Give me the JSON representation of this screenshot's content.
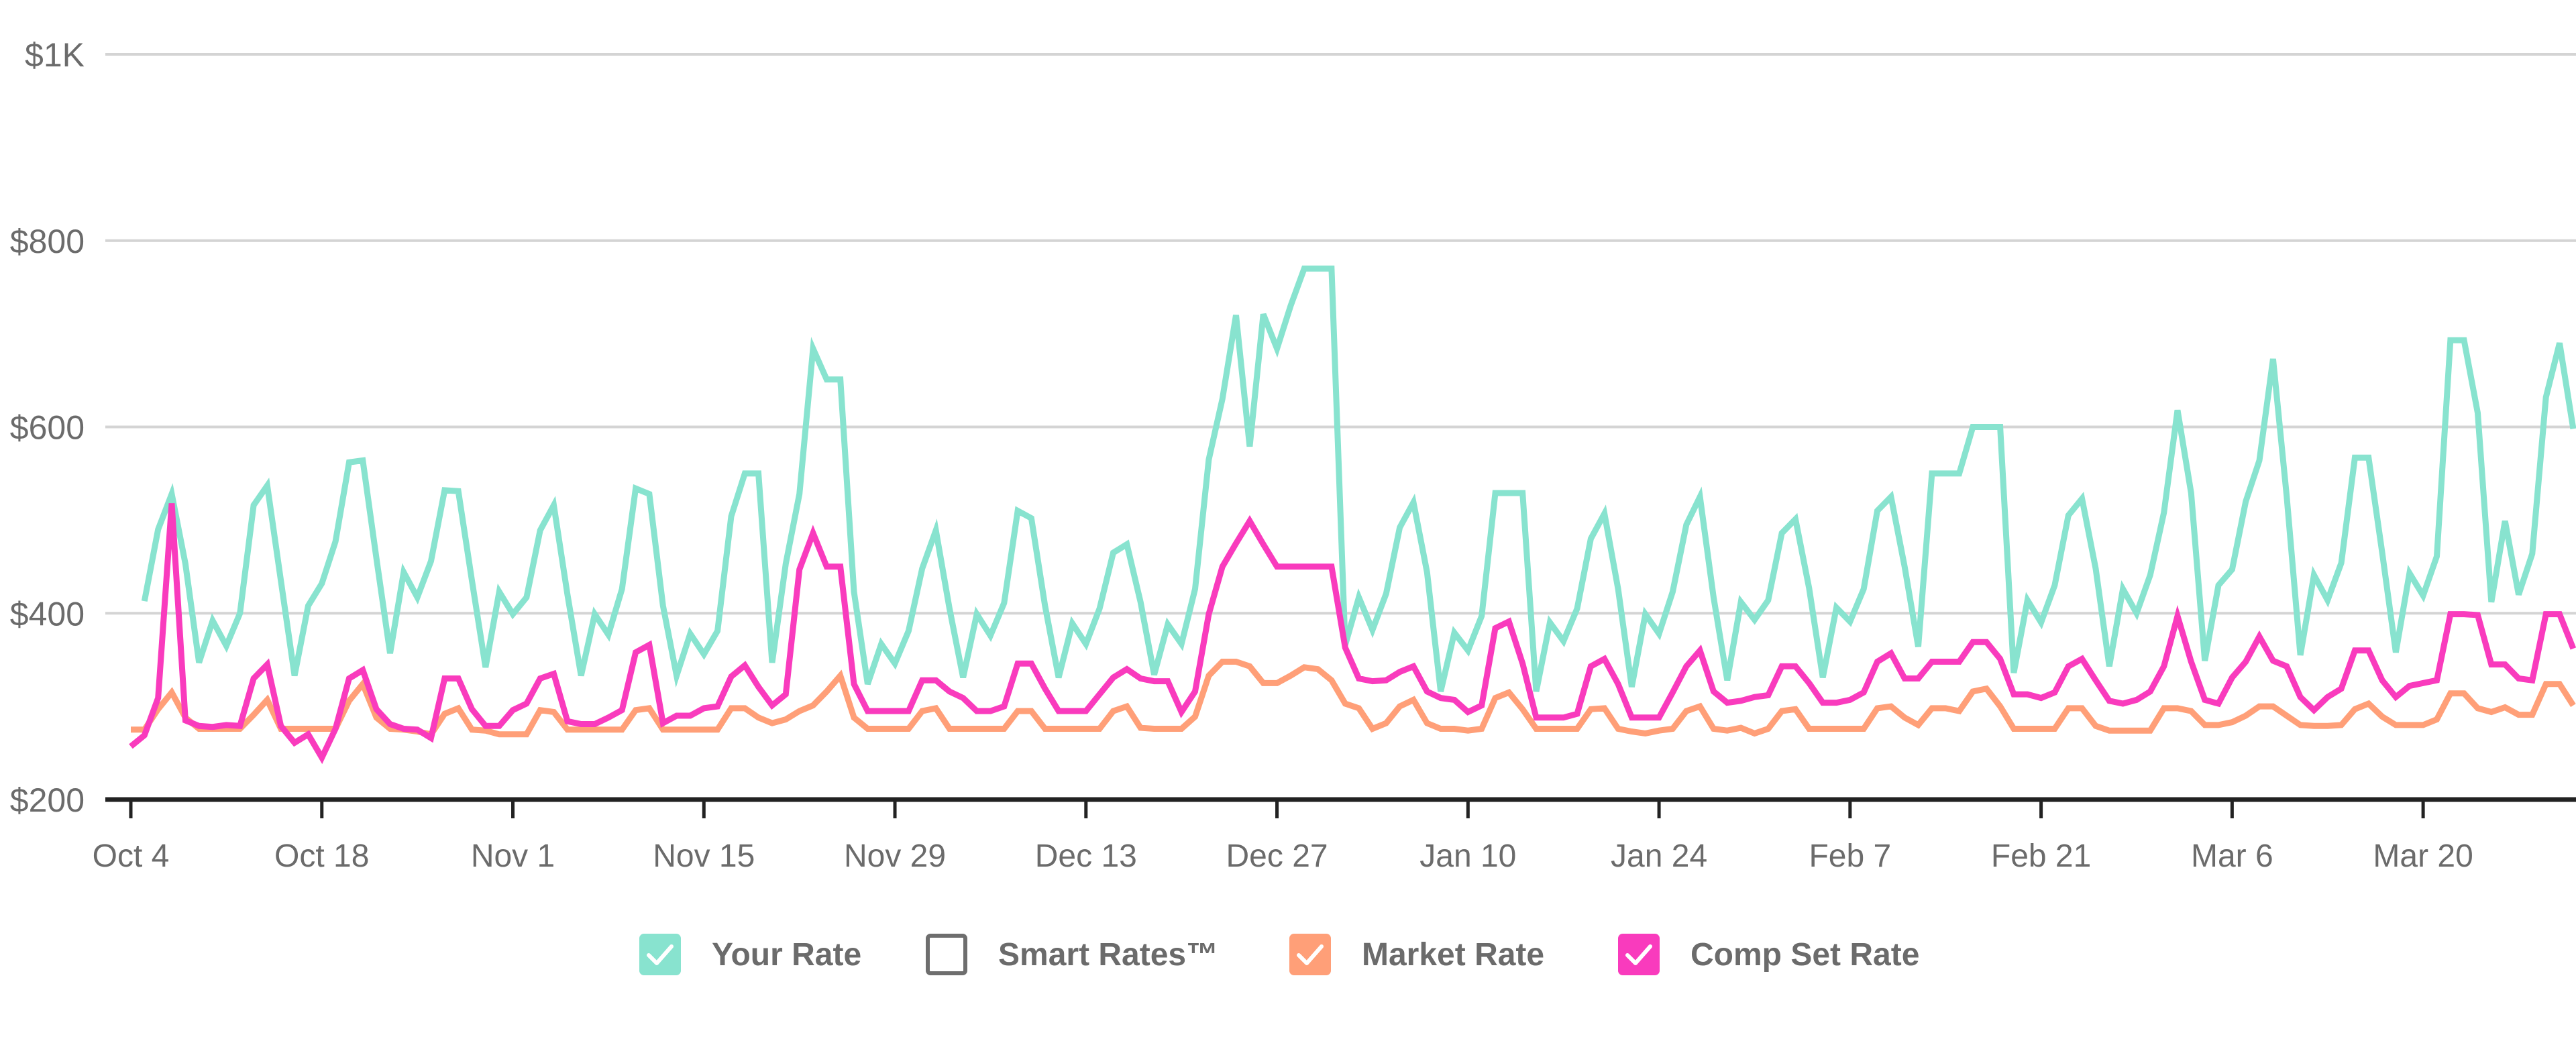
{
  "chart_data": {
    "type": "line",
    "title": "",
    "xlabel": "",
    "ylabel": "",
    "start_date": "Oct 4",
    "x_unit": "day",
    "ylim": [
      200,
      1000
    ],
    "y_ticks": [
      {
        "value": 200,
        "label": "$200"
      },
      {
        "value": 400,
        "label": "$400"
      },
      {
        "value": 600,
        "label": "$600"
      },
      {
        "value": 800,
        "label": "$800"
      },
      {
        "value": 1000,
        "label": "$1K"
      }
    ],
    "x_ticks": [
      {
        "day": 0,
        "label": "Oct 4"
      },
      {
        "day": 14,
        "label": "Oct 18"
      },
      {
        "day": 28,
        "label": "Nov 1"
      },
      {
        "day": 42,
        "label": "Nov 15"
      },
      {
        "day": 56,
        "label": "Nov 29"
      },
      {
        "day": 70,
        "label": "Dec 13"
      },
      {
        "day": 84,
        "label": "Dec 27"
      },
      {
        "day": 98,
        "label": "Jan 10"
      },
      {
        "day": 112,
        "label": "Jan 24"
      },
      {
        "day": 126,
        "label": "Feb 7"
      },
      {
        "day": 140,
        "label": "Feb 21"
      },
      {
        "day": 154,
        "label": "Mar 6"
      },
      {
        "day": 168,
        "label": "Mar 20"
      }
    ],
    "xlim_days": [
      0,
      179
    ],
    "grid": true,
    "legend_position": "bottom-center",
    "series": [
      {
        "name": "Your Rate",
        "color": "#88e3cf",
        "visible": true,
        "values": [
          null,
          413,
          490,
          528,
          453,
          347,
          392,
          365,
          400,
          516,
          537,
          435,
          333,
          408,
          432,
          477,
          562,
          564,
          459,
          357,
          444,
          417,
          456,
          532,
          531,
          435,
          342,
          423,
          399,
          417,
          489,
          516,
          420,
          333,
          399,
          377,
          426,
          534,
          528,
          408,
          333,
          378,
          356,
          381,
          504,
          550,
          550,
          347,
          453,
          528,
          684,
          651,
          651,
          423,
          324,
          367,
          346,
          381,
          448,
          489,
          405,
          331,
          399,
          376,
          411,
          510,
          502,
          408,
          331,
          389,
          367,
          405,
          465,
          474,
          412,
          334,
          388,
          367,
          426,
          565,
          630,
          720,
          579,
          721,
          684,
          730,
          770,
          770,
          770,
          366,
          417,
          382,
          421,
          492,
          519,
          444,
          316,
          379,
          360,
          397,
          529,
          529,
          529,
          316,
          390,
          370,
          405,
          480,
          507,
          426,
          321,
          399,
          378,
          423,
          495,
          525,
          417,
          328,
          412,
          393,
          414,
          486,
          501,
          427,
          331,
          406,
          391,
          426,
          510,
          525,
          450,
          364,
          550,
          550,
          550,
          600,
          600,
          600,
          336,
          414,
          390,
          430,
          505,
          523,
          448,
          343,
          426,
          400,
          441,
          508,
          618,
          529,
          349,
          430,
          447,
          520,
          564,
          673,
          526,
          355,
          441,
          414,
          454,
          567,
          567,
          465,
          358,
          443,
          419,
          461,
          693,
          693,
          615,
          412,
          499,
          420,
          464,
          632,
          690,
          598
        ]
      },
      {
        "name": "Smart Rates™",
        "color": "#6e6e6e",
        "visible": false,
        "values": []
      },
      {
        "name": "Market Rate",
        "color": "#ff9f78",
        "visible": true,
        "values": [
          275,
          275,
          297,
          315,
          288,
          276,
          276,
          276,
          276,
          291,
          307,
          276,
          276,
          276,
          276,
          276,
          306,
          324,
          288,
          276,
          275,
          273,
          270,
          292,
          298,
          275,
          274,
          270,
          270,
          270,
          296,
          294,
          275,
          275,
          275,
          275,
          275,
          296,
          298,
          275,
          275,
          275,
          275,
          275,
          298,
          298,
          288,
          282,
          286,
          295,
          301,
          316,
          333,
          288,
          276,
          276,
          276,
          276,
          295,
          298,
          276,
          276,
          276,
          276,
          276,
          295,
          295,
          276,
          276,
          276,
          276,
          276,
          295,
          300,
          277,
          276,
          276,
          276,
          289,
          333,
          348,
          348,
          343,
          325,
          325,
          333,
          342,
          340,
          328,
          303,
          298,
          276,
          282,
          300,
          307,
          282,
          276,
          276,
          274,
          276,
          309,
          315,
          297,
          276,
          276,
          276,
          276,
          297,
          298,
          276,
          273,
          271,
          274,
          276,
          295,
          300,
          276,
          274,
          277,
          271,
          276,
          295,
          297,
          276,
          276,
          276,
          276,
          276,
          298,
          300,
          288,
          280,
          298,
          298,
          295,
          316,
          319,
          300,
          276,
          276,
          276,
          276,
          298,
          298,
          279,
          274,
          274,
          274,
          274,
          298,
          298,
          295,
          280,
          280,
          283,
          290,
          300,
          300,
          290,
          280,
          279,
          279,
          280,
          297,
          303,
          289,
          280,
          280,
          280,
          286,
          314,
          314,
          298,
          294,
          299,
          291,
          291,
          324,
          324,
          301
        ]
      },
      {
        "name": "Comp Set Rate",
        "color": "#f93bbd",
        "visible": true,
        "values": [
          257,
          269,
          309,
          518,
          285,
          279,
          278,
          280,
          279,
          330,
          345,
          279,
          261,
          270,
          245,
          276,
          330,
          339,
          297,
          281,
          276,
          275,
          266,
          330,
          330,
          297,
          279,
          279,
          296,
          303,
          330,
          335,
          284,
          281,
          281,
          288,
          296,
          358,
          366,
          282,
          290,
          290,
          298,
          300,
          332,
          344,
          321,
          301,
          313,
          447,
          486,
          450,
          450,
          324,
          295,
          295,
          295,
          295,
          328,
          328,
          316,
          309,
          295,
          295,
          300,
          346,
          346,
          319,
          295,
          295,
          295,
          313,
          331,
          340,
          330,
          327,
          327,
          294,
          316,
          399,
          450,
          475,
          499,
          474,
          450,
          450,
          450,
          450,
          450,
          363,
          330,
          327,
          328,
          337,
          343,
          316,
          309,
          307,
          294,
          301,
          384,
          391,
          346,
          288,
          288,
          288,
          292,
          343,
          351,
          324,
          288,
          288,
          288,
          315,
          343,
          360,
          316,
          304,
          306,
          310,
          312,
          343,
          343,
          325,
          304,
          304,
          307,
          315,
          348,
          357,
          330,
          330,
          348,
          348,
          348,
          369,
          369,
          351,
          313,
          313,
          309,
          315,
          343,
          351,
          328,
          306,
          303,
          307,
          316,
          343,
          397,
          348,
          307,
          303,
          331,
          348,
          375,
          349,
          343,
          310,
          296,
          310,
          319,
          360,
          360,
          328,
          310,
          322,
          325,
          328,
          399,
          399,
          398,
          345,
          345,
          330,
          328,
          399,
          399,
          362
        ]
      }
    ]
  },
  "legend": {
    "items": [
      {
        "label": "Your Rate",
        "checked": true,
        "color": "#88e3cf"
      },
      {
        "label": "Smart Rates™",
        "checked": false,
        "color": "#6e6e6e"
      },
      {
        "label": "Market Rate",
        "checked": true,
        "color": "#ff9f78"
      },
      {
        "label": "Comp Set Rate",
        "checked": true,
        "color": "#f93bbd"
      }
    ]
  },
  "colors": {
    "gridline": "#d4d4d4",
    "axis": "#222222",
    "tick_text": "#6b6b6b"
  }
}
